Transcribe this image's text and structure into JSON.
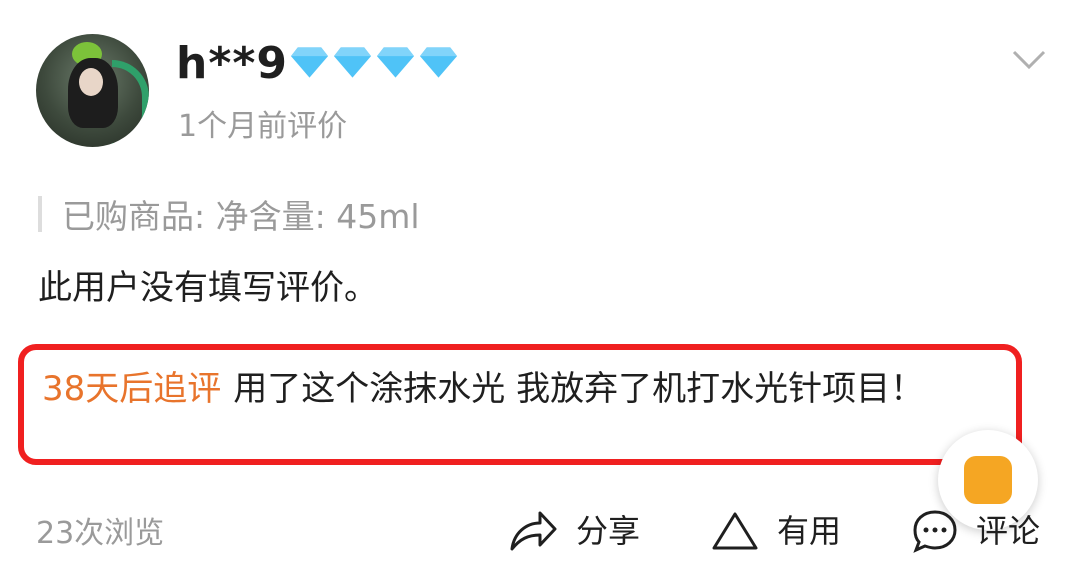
{
  "user": {
    "name": "h**9",
    "level_icons": [
      "diamond-icon",
      "diamond-icon",
      "diamond-icon",
      "diamond-icon"
    ],
    "time": "1个月前评价"
  },
  "purchase": {
    "text": "已购商品: 净含量: 45ml"
  },
  "review": {
    "text": "此用户没有填写评价。"
  },
  "followup": {
    "tag": "38天后追评",
    "text": "用了这个涂抹水光  我放弃了机打水光针项目！"
  },
  "footer": {
    "views": "23次浏览",
    "share_label": "分享",
    "useful_label": "有用",
    "comment_label": "评论"
  },
  "colors": {
    "accent_orange": "#e8742c",
    "highlight_red": "#f02020",
    "fab_orange": "#f5a623",
    "gem_blue": "#4fc3f7"
  }
}
